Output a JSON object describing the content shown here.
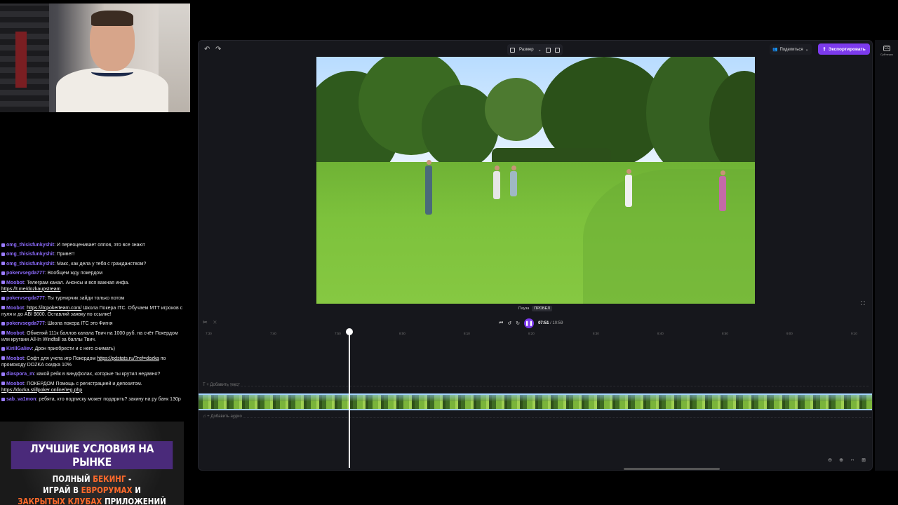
{
  "editor": {
    "toolbar": {
      "size_label": "Размер",
      "share_label": "Поделиться",
      "export_label": "Экспортировать"
    },
    "right_rail": {
      "subtitles_label": "Субтитры"
    },
    "playback": {
      "tooltip_label": "Пауза",
      "tooltip_key": "ПРОБЕЛ",
      "current_time": "07:51",
      "total_time": "/ 10:59"
    },
    "ruler": [
      "7:30",
      "7:40",
      "7:50",
      "8:00",
      "8:10",
      "8:20",
      "8:30",
      "8:40",
      "8:50",
      "9:00",
      "9:10"
    ],
    "tracks": {
      "add_text": "+ Добавить текст",
      "add_audio": "+ Добавить аудио"
    }
  },
  "chat": [
    {
      "user": "omg_thisisfunkyshit",
      "text": "И переоценивает оппов, это все знают"
    },
    {
      "user": "omg_thisisfunkyshit",
      "text": "Привет!"
    },
    {
      "user": "omg_thisisfunkyshit",
      "text": "Макс, как дела у тебя с гражданством?"
    },
    {
      "user": "pokervsegda777",
      "text": "Вообщем жду покердом"
    },
    {
      "user": "Moobot",
      "text": "Телеграм канал. Анонсы и вся важная инфа.",
      "link": "https://t.me/dozkaupstream"
    },
    {
      "user": "pokervsegda777",
      "text": "Ты турнирчик зайди только потом"
    },
    {
      "user": "Moobot",
      "link": "https://itcpokerteam.com/",
      "text": "Школа Покера ITC. Обучаем МТТ игроков с нуля и до ABI $600. Оставляй заявку по ссылке!"
    },
    {
      "user": "pokervsegda777",
      "text": "Школа покера ITC это Фигня"
    },
    {
      "user": "Moobot",
      "text": "Обменяй 111к баллов канала Твич на 1000 руб. на счёт Покердом или крутани All-In Windfall за баллы Твич."
    },
    {
      "user": "KirillGaliev",
      "text": "Дрон приобрести и с него снимать)"
    },
    {
      "user": "Moobot",
      "text": "Софт для учета игр Покердом",
      "link": "https://pdstats.ru/?ref=dozka",
      "text2": "по промокоду DOZKA скидка 10%"
    },
    {
      "user": "diaspora_m",
      "text": "какой рейк в виндфолах, которые ты крутил недавно?"
    },
    {
      "user": "Moobot",
      "text": "ПОКЕРДОМ Помощь с регистрацией и депозитом.",
      "link": "https://dozka.stillpoker.online/reg.php"
    },
    {
      "user": "sab_va1mon",
      "text": "ребята, кто подписку может подарить? закину на ру банк 130р"
    }
  ],
  "promo": {
    "banner": "ЛУЧШИЕ УСЛОВИЯ НА РЫНКЕ",
    "line1_a": "ПОЛНЫЙ ",
    "line1_b": "БЕКИНГ",
    "line1_c": " -",
    "line2_a": "ИГРАЙ В ",
    "line2_b": "ЕВРОРУМАХ",
    "line2_c": " И",
    "line3_a": "ЗАКРЫТЫХ КЛУБАХ",
    "line3_b": " ПРИЛОЖЕНИЙ"
  },
  "colors": {
    "accent": "#7c3aed",
    "chat_user": "#8e6cff",
    "promo_highlight": "#ff6a2b"
  }
}
